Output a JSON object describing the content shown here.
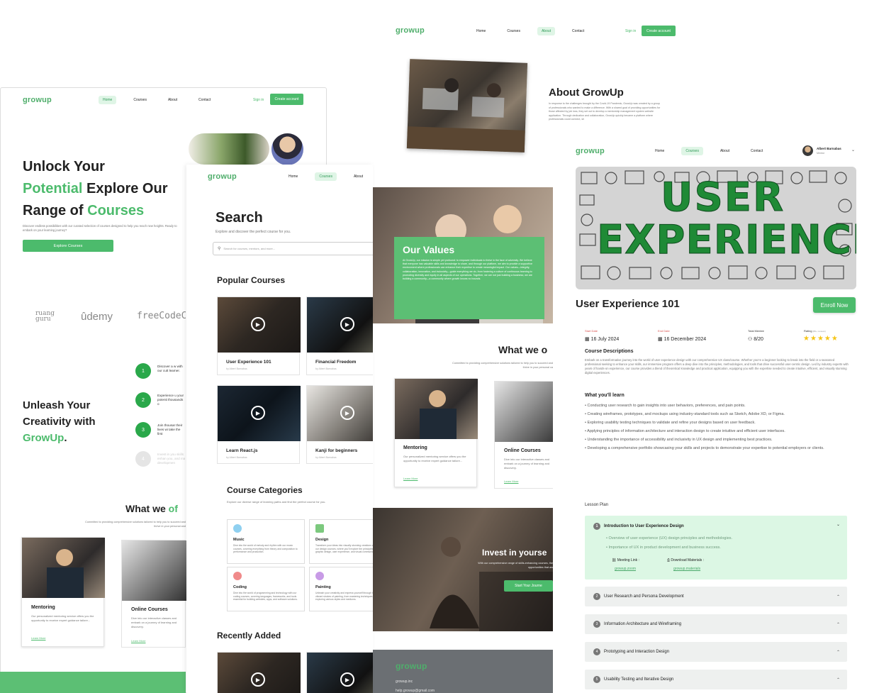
{
  "about_page": {
    "logo": "growup",
    "nav": [
      "Home",
      "Courses",
      "About",
      "Contact"
    ],
    "sign_in": "Sign in",
    "create_account": "Create account",
    "title": "About GrowUp",
    "body": "In response to the challenges brought by the Covid-19 Pandemic, GrowUp was created by a group of professionals who wanted to make a difference. With a shared goal of providing opportunities for those affected by job loss, they set out to develop a mentorship management system website application. Through dedication and collaboration, GrowUp quickly became a platform where professionals could connect, sh",
    "values_title": "Our Values",
    "values_body": "At GrowUp, our mission is simple yet profound: to empower individuals to thrive in the face of adversity. We believe that everyone has valuable skills and knowledge to share, and through our platform, we aim to provide a supportive environment where professionals can enhance their expertise to create meaningful impact. Our values—integrity, collaboration, innovation, and inclusivity—guide everything we do, from fostering a culture of continuous learning to promoting diversity and equity in all aspects of our operations. Together, we are not just building a business; we are building a community—a community where growth knows no bounds.",
    "what_we_offer_title": "What we o",
    "what_we_offer_sub": "Committed to providing comprehensive solutions tailored to help you to succeed and thrive in your personal ca",
    "offers": [
      {
        "title": "Mentoring",
        "desc": "Our personalized mentoring service offers you the opportunity to receive expert guidance tailore...",
        "link": "Learn More"
      },
      {
        "title": "Online Courses",
        "desc": "Dive into our interactive classes and embark on a journey of learning and discovery.",
        "link": "Learn More"
      }
    ],
    "invest_title": "Invest in yourse",
    "invest_sub": "With our comprehensive range of skills-enhancing courses, the opportunities that aw",
    "invest_button": "Start Your Journe",
    "footer_logo": "growup",
    "footer_line1": "growup.inc",
    "footer_line2": "help.growup@gmail.com"
  },
  "home_page": {
    "logo": "growup",
    "nav": [
      "Home",
      "Courses",
      "About",
      "Contact"
    ],
    "sign_in": "Sign in",
    "create_account": "Create account",
    "hero_l1a": "Unlock Your",
    "hero_l2a": "Potential",
    "hero_l2b": " Explore Our",
    "hero_l3a": "Range of ",
    "hero_l3b": "Courses",
    "hero_sub": "Discover endless possibilities with our curated selection of courses designed to help you reach new heights. Ready to embark on your learning journey?",
    "explore_button": "Explore Courses",
    "partners": [
      "ruang guru",
      "ûdemy",
      "freeCodeC"
    ],
    "unleash_l1": "Unleash Your",
    "unleash_l2": "Creativity with",
    "unleash_l3": "GrowUp",
    "unleash_dot": ".",
    "steps": [
      {
        "num": "1",
        "text": "Discover a w with our cutt learner."
      },
      {
        "num": "2",
        "text": "Experience u your potenti thousands o"
      },
      {
        "num": "3",
        "text": "Join thousar their lives wi take the first"
      },
      {
        "num": "4",
        "text": "Invest in you skills enhan you, and ma developmen"
      }
    ],
    "what_we_title_a": "What we ",
    "what_we_title_b": "of",
    "what_we_sub": "Committed to providing comprehensive solutions tailored to help you to succeed and thrive in your personal and",
    "offers": [
      {
        "title": "Mentoring",
        "desc": "Our personalized mentoring service offers you the opportunity to receive expert guidance tailore...",
        "link": "Learn More"
      },
      {
        "title": "Online Courses",
        "desc": "Dive into our interactive classes and embark on a journey of learning and discovery.",
        "link": "Learn More"
      }
    ]
  },
  "courses_page": {
    "logo": "growup",
    "nav": [
      "Home",
      "Courses",
      "About",
      "C"
    ],
    "search_title": "Search",
    "search_sub": "Explore and discover the perfect course for you.",
    "search_placeholder": "Search for courses, mentors, and more...",
    "popular_title": "Popular Courses",
    "popular": [
      {
        "title": "User Experience 101",
        "mentor": "by Albert Barnabas"
      },
      {
        "title": "Financial Freedom",
        "mentor": "by Albert Barnabas"
      },
      {
        "title": "Learn React.js",
        "mentor": "by Albert Barnabas"
      },
      {
        "title": "Kanji for beginners",
        "mentor": "by Albert Barnabas"
      }
    ],
    "categories_title": "Course Categories",
    "categories_sub": "Explore our diverse range of learning paths and find the perfect course for you.",
    "categories": [
      {
        "title": "Music",
        "desc": "Dive into the world of melody and rhythm with our music courses, covering everything from theory and composition to performance and production."
      },
      {
        "title": "Design",
        "desc": "Transform your ideas into visually stunning creations with our design courses, where you'll explore the principles of graphic design, user experience, and visual communication."
      },
      {
        "title": "Coding",
        "desc": "Dive into the world of programming and technology with our coding courses, covering languages, frameworks, and tools essential for building websites, apps, and software solutions."
      },
      {
        "title": "Painting",
        "desc": "Unleash your creativity and express yourself through the vibrant strokes of painting, from mastering techniques to exploring various styles and mediums."
      }
    ],
    "recent_title": "Recently Added"
  },
  "detail_page": {
    "logo": "growup",
    "nav": [
      "Home",
      "Courses",
      "About",
      "Contact"
    ],
    "user_name": "Albert Barnabas",
    "user_role": "Mentor",
    "banner_l1": "USER",
    "banner_l2": "EXPERIENCE",
    "course_title": "User Experience 101",
    "enroll_button": "Enroll Now",
    "start_label": "Start Date",
    "start_value": "16 July 2024",
    "end_label": "End Date",
    "end_value": "16 December 2024",
    "mentee_label": "Total Mentee",
    "mentee_value": "8/20",
    "rating_label": "Rating",
    "rating_count": "(80+ reviews)",
    "rating_value": 5,
    "desc_title": "Course Descriptions",
    "desc_body": "Embark on a transformative journey into the world of user experience design with our comprehensive UX class/course. Whether you're a beginner looking to break into the field or a seasoned professional seeking to enhance your skills, our immersive program offers a deep dive into the principles, methodologies, and tools that drive successful user-centric design. Led by industry experts with years of hands-on experience, our course provides a blend of theoretical knowledge and practical application, equipping you with the expertise needed to create intuitive, efficient, and visually stunning digital experiences.",
    "learn_title": "What you'll learn",
    "learn": [
      "Conducting user research to gain insights into user behaviors, preferences, and pain points.",
      "Creating wireframes, prototypes, and mockups using industry-standard tools such as Sketch, Adobe XD, or Figma.",
      "Exploring usability testing techniques to validate and refine your designs based on user feedback.",
      "Applying principles of information architecture and interaction design to create intuitive and efficient user interfaces.",
      "Understanding the importance of accessibility and inclusivity in UX design and implementing best practices.",
      "Developing a comprehensive portfolio showcasing your skills and projects to demonstrate your expertise to potential employers or clients."
    ],
    "lesson_plan_title": "Lesson Plan",
    "lessons": [
      {
        "num": "1",
        "title": "Introduction to User Experience Design"
      },
      {
        "num": "2",
        "title": "User Research and Persona Development"
      },
      {
        "num": "3",
        "title": "Information Architecture and Wireframing"
      },
      {
        "num": "4",
        "title": "Prototyping and Interaction Design"
      },
      {
        "num": "5",
        "title": "Usability Testing and Iterative Design"
      }
    ],
    "lesson1_points": [
      "Overview of user experience (UX) design principles and methodologies.",
      "Importance of UX in product development and business success."
    ],
    "meeting_label": "Meeting Link :",
    "meeting_link": "growup.zoom",
    "download_label": "Download Materials :",
    "download_link": "growup.materials"
  },
  "colors": {
    "accent": "#4cbb6c",
    "accent_light": "#dff5e6",
    "dark_footer": "#6b6f73"
  },
  "icons": [
    "play-icon",
    "search-icon",
    "calendar-icon",
    "user-icon",
    "star-icon",
    "chevron-down-icon",
    "chevron-up-icon",
    "link-icon",
    "download-icon"
  ]
}
